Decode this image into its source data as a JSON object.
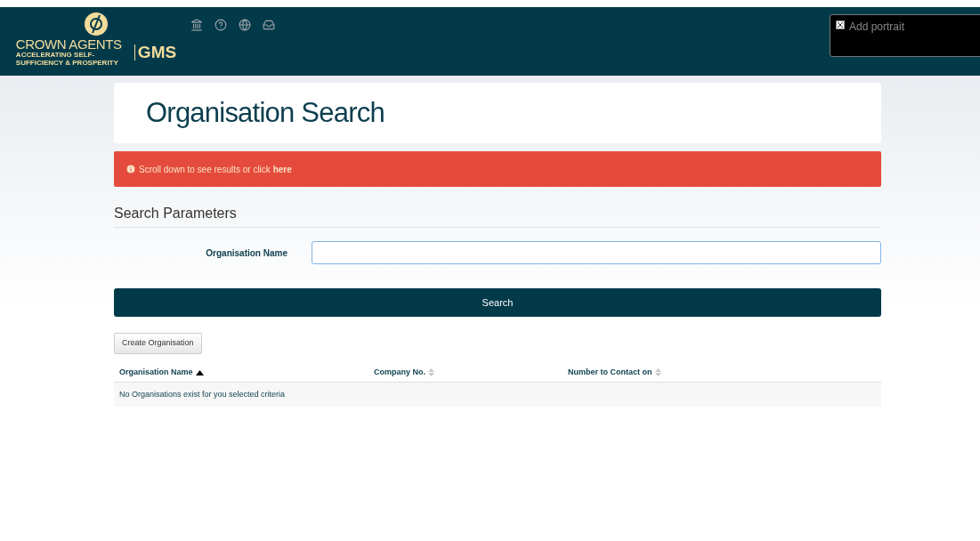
{
  "header": {
    "logo": {
      "name": "CROWN AGENTS",
      "tagline": "ACCELERATING SELF-SUFFICIENCY & PROSPERITY",
      "product": "GMS"
    },
    "portrait": {
      "label": "Add portrait"
    }
  },
  "page": {
    "title": "Organisation Search"
  },
  "alert": {
    "text": "Scroll down to see results or click ",
    "link": "here"
  },
  "search_parameters": {
    "heading": "Search Parameters",
    "fields": [
      {
        "label": "Organisation Name"
      }
    ],
    "button": "Search"
  },
  "create_button": "Create Organisation",
  "table": {
    "columns": [
      {
        "label": "Organisation Name",
        "sorted": true
      },
      {
        "label": "Company No.",
        "sorted": false
      },
      {
        "label": "Number to Contact on",
        "sorted": false
      }
    ],
    "empty_message": "No Organisations exist for you selected criteria"
  }
}
